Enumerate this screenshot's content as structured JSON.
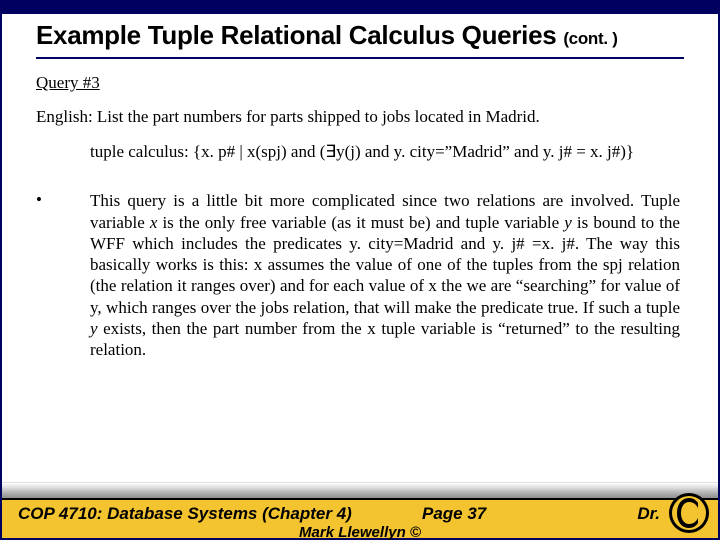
{
  "title_main": "Example Tuple Relational Calculus Queries ",
  "title_cont": "(cont. )",
  "query_label": "Query #3",
  "english_prefix": "English:  ",
  "english_text": "List the part numbers for parts shipped to jobs located in Madrid.",
  "tuple_prefix": "tuple calculus:  ",
  "tuple_expr": "{x. p# | x(spj) and (∃y(j) and y. city=”Madrid” and y. j# = x. j#)}",
  "bullet": "•",
  "body_p1a": "This query is a little bit more complicated since two relations are involved.  Tuple variable ",
  "body_p1b_it": "x",
  "body_p1c": " is the only free variable (as it must be) and tuple variable ",
  "body_p1d_it": "y",
  "body_p1e": " is bound to the WFF which includes the predicates y. city=Madrid and y. j# =x. j#.  The way this basically works is this:  x assumes the value of one of the tuples from the spj relation (the relation it ranges over) and for each value of x the we are “searching” for value of y, which ranges over the jobs relation, that will make the predicate true.  If such a tuple ",
  "body_p1f_it": "y",
  "body_p1g": " exists, then the part number from the x tuple variable is “returned” to the resulting relation.",
  "footer": {
    "left": "COP 4710: Database Systems  (Chapter 4)",
    "center": "Page 37",
    "right": "Dr.",
    "author": "Mark Llewellyn ©"
  }
}
